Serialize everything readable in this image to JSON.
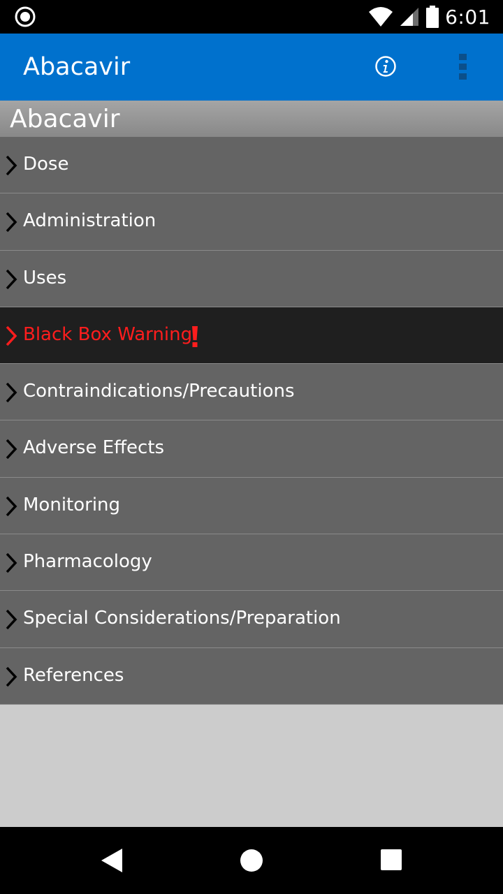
{
  "status_bar": {
    "time": "6:01",
    "left_icon": "recording-circle-icon",
    "icons": [
      "wifi-icon",
      "cell-signal-icon",
      "battery-icon"
    ]
  },
  "app_bar": {
    "title": "Abacavir",
    "background": "#0071cd",
    "actions": [
      "info-icon",
      "overflow-menu-icon"
    ]
  },
  "section": {
    "title": "Abacavir"
  },
  "menu": {
    "items": [
      {
        "label": "Dose"
      },
      {
        "label": "Administration"
      },
      {
        "label": "Uses"
      },
      {
        "label": "Black Box Warning",
        "warning": true,
        "color": "#ff1d1d"
      },
      {
        "label": "Contraindications/Precautions"
      },
      {
        "label": "Adverse Effects"
      },
      {
        "label": "Monitoring"
      },
      {
        "label": "Pharmacology"
      },
      {
        "label": "Special Considerations/Preparation"
      },
      {
        "label": "References"
      }
    ]
  },
  "nav_bar": {
    "buttons": [
      "back-icon",
      "home-icon",
      "recent-apps-icon"
    ]
  }
}
